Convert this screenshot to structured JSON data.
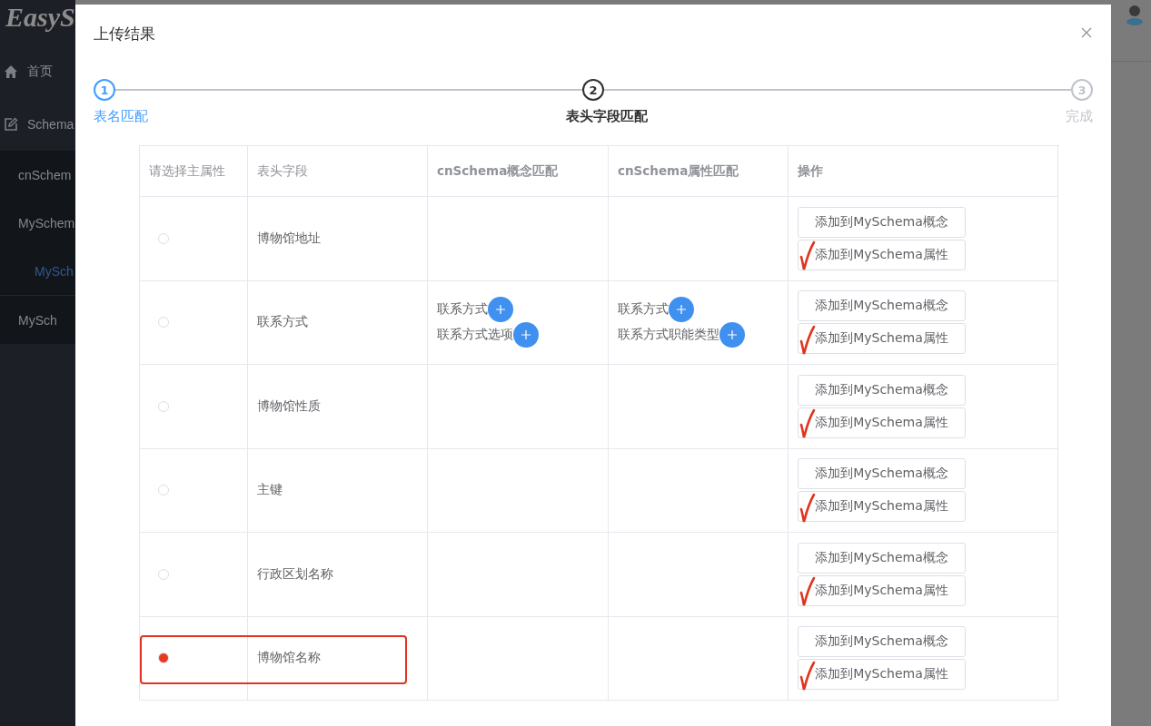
{
  "sidebar": {
    "logo": "EasyS",
    "items": [
      {
        "label": "首页",
        "kind": "home",
        "selected": false
      },
      {
        "label": "Schema",
        "kind": "edit",
        "selected": false,
        "children": [
          {
            "label": "cnSchem",
            "selected": false
          },
          {
            "label": "MySchem",
            "selected": false,
            "children": [
              {
                "label": "MySch",
                "selected": true
              }
            ]
          },
          {
            "label": "MySch",
            "selected": false
          }
        ]
      }
    ]
  },
  "dialog": {
    "title": "上传结果",
    "steps": [
      {
        "number": "1",
        "label": "表名匹配",
        "completed": true,
        "selected": false
      },
      {
        "number": "2",
        "label": "表头字段匹配",
        "completed": false,
        "selected": true
      },
      {
        "number": "3",
        "label": "完成",
        "completed": false,
        "selected": false
      }
    ],
    "table": {
      "columns": [
        "请选择主属性",
        "表头字段",
        "cnSchema概念匹配",
        "cnSchema属性匹配",
        "操作"
      ],
      "rows": [
        {
          "selected": false,
          "highlighted": false,
          "checkmark": true,
          "field": "博物馆地址",
          "concepts": [],
          "attributes": [],
          "actions": [
            "添加到MySchema概念",
            "添加到MySchema属性"
          ]
        },
        {
          "selected": false,
          "highlighted": false,
          "checkmark": true,
          "field": "联系方式",
          "concepts": [
            "联系方式",
            "联系方式选项"
          ],
          "attributes": [
            "联系方式",
            "联系方式职能类型"
          ],
          "actions": [
            "添加到MySchema概念",
            "添加到MySchema属性"
          ]
        },
        {
          "selected": false,
          "highlighted": false,
          "checkmark": true,
          "field": "博物馆性质",
          "concepts": [],
          "attributes": [],
          "actions": [
            "添加到MySchema概念",
            "添加到MySchema属性"
          ]
        },
        {
          "selected": false,
          "highlighted": false,
          "checkmark": true,
          "field": "主键",
          "concepts": [],
          "attributes": [],
          "actions": [
            "添加到MySchema概念",
            "添加到MySchema属性"
          ]
        },
        {
          "selected": false,
          "highlighted": false,
          "checkmark": true,
          "field": "行政区划名称",
          "concepts": [],
          "attributes": [],
          "actions": [
            "添加到MySchema概念",
            "添加到MySchema属性"
          ]
        },
        {
          "selected": true,
          "highlighted": true,
          "checkmark": true,
          "field": "博物馆名称",
          "concepts": [],
          "attributes": [],
          "actions": [
            "添加到MySchema概念",
            "添加到MySchema属性"
          ]
        }
      ]
    }
  }
}
